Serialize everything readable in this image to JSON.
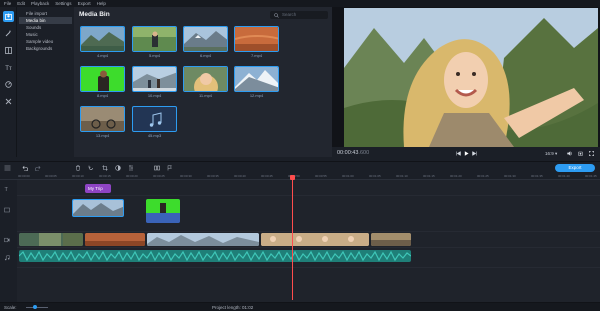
{
  "menu": [
    "File",
    "Edit",
    "Playback",
    "Settings",
    "Export",
    "Help"
  ],
  "tools": [
    {
      "name": "import-tool-icon",
      "active": true
    },
    {
      "name": "magic-wand-icon",
      "active": false
    },
    {
      "name": "transitions-icon",
      "active": false
    },
    {
      "name": "titles-icon",
      "active": false
    },
    {
      "name": "stickers-icon",
      "active": false
    },
    {
      "name": "more-tools-icon",
      "active": false
    }
  ],
  "categories": [
    "File import",
    "Media bin",
    "Sounds",
    "Music",
    "Sample video",
    "Backgrounds"
  ],
  "selected_category": "Media bin",
  "media_bin": {
    "title": "Media Bin",
    "search_placeholder": "Search",
    "items": [
      {
        "label": "4.mp4"
      },
      {
        "label": "5.mp4"
      },
      {
        "label": "6.mp4"
      },
      {
        "label": "7.mp4"
      },
      {
        "label": "8.mp4"
      },
      {
        "label": "10.mp4"
      },
      {
        "label": "11.mp4"
      },
      {
        "label": "12.mp4"
      },
      {
        "label": "13.mp4"
      },
      {
        "label": "45.mp3"
      }
    ]
  },
  "player": {
    "timecode": "00:00:43",
    "timecode_ms": ".600",
    "aspect": "16:9 ▾",
    "progress": 0.69
  },
  "export_label": "Export",
  "ruler_labels": [
    "00:00:00",
    "00:00:05",
    "00:00:10",
    "00:00:15",
    "00:00:20",
    "00:00:25",
    "00:00:30",
    "00:00:35",
    "00:00:40",
    "00:00:45",
    "00:00:50",
    "00:00:55",
    "00:01:00",
    "00:01:05",
    "00:01:10",
    "00:01:15",
    "00:01:20",
    "00:01:25",
    "00:01:30",
    "00:01:35",
    "00:01:40",
    "00:01:45"
  ],
  "title_clip_label": "My Trip",
  "status": {
    "scale_label": "Scale:",
    "project_length": "Project length: 01:02"
  },
  "colors": {
    "accent": "#2d9cf2",
    "playhead": "#ff4d4d",
    "audio_wave": "#3fc6b8",
    "title_clip": "#8e44c4"
  }
}
